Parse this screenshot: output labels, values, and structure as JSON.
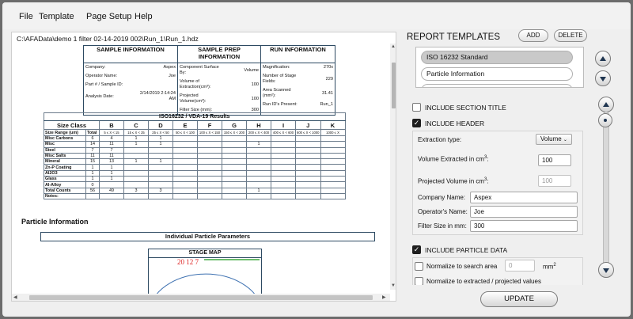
{
  "menu": [
    "File",
    "Template",
    "Page Setup",
    "Help"
  ],
  "document": {
    "path": "C:\\AFAData\\demo 1 filter 02-14-2019 002\\Run_1\\Run_1.hdz",
    "sample_info": {
      "title": "SAMPLE INFORMATION",
      "rows": [
        [
          "Company:",
          "Aspex"
        ],
        [
          "Operator Name:",
          "Joe"
        ],
        [
          "Part # / Sample ID:",
          ""
        ],
        [
          "Analysis Date:",
          "2/14/2019 2:14:24 AM"
        ]
      ]
    },
    "sample_prep": {
      "title": "SAMPLE PREP INFORMATION",
      "rows": [
        [
          "Component Surface By:",
          "Volume"
        ],
        [
          "Volume of Extraction(cm³):",
          "100"
        ],
        [
          "Projected Volume(cm³):",
          "100"
        ],
        [
          "Filter Size (mm):",
          "300"
        ]
      ]
    },
    "run_info": {
      "title": "RUN INFORMATION",
      "rows": [
        [
          "Magnification:",
          "270x"
        ],
        [
          "Number of Stage Fields:",
          "229"
        ],
        [
          "Area Scanned (mm²):",
          "31.41"
        ],
        [
          "Run ID's Present:",
          "Run_1"
        ]
      ]
    },
    "iso": {
      "title": "ISO16232 / VDA-19 Results",
      "size_class_label": "Size Class",
      "classes": [
        "B",
        "C",
        "D",
        "E",
        "F",
        "G",
        "H",
        "I",
        "J",
        "K"
      ],
      "range_label": "Size Range (um)",
      "total_label": "Total",
      "ranges": [
        "5 ≤ X < 15",
        "15 ≤ X < 25",
        "25 ≤ X < 50",
        "50 ≤ X < 100",
        "100 ≤ X < 150",
        "150 ≤ X < 200",
        "200 ≤ X < 400",
        "400 ≤ X < 600",
        "600 ≤ X < 1000",
        "1000 ≤ X"
      ],
      "rows": [
        {
          "label": "Misc Carbons",
          "total": "6",
          "cells": [
            "4",
            "1",
            "1",
            "",
            "",
            "",
            "",
            "",
            "",
            ""
          ]
        },
        {
          "label": "Misc",
          "total": "14",
          "cells": [
            "11",
            "1",
            "1",
            "",
            "",
            "",
            "1",
            "",
            "",
            ""
          ]
        },
        {
          "label": "Steel",
          "total": "7",
          "cells": [
            "7",
            "",
            "",
            "",
            "",
            "",
            "",
            "",
            "",
            ""
          ]
        },
        {
          "label": "Misc Salts",
          "total": "11",
          "cells": [
            "11",
            "",
            "",
            "",
            "",
            "",
            "",
            "",
            "",
            ""
          ]
        },
        {
          "label": "Mineral",
          "total": "15",
          "cells": [
            "13",
            "1",
            "1",
            "",
            "",
            "",
            "",
            "",
            "",
            ""
          ]
        },
        {
          "label": "Zn-P Coating",
          "total": "1",
          "cells": [
            "1",
            "",
            "",
            "",
            "",
            "",
            "",
            "",
            "",
            ""
          ]
        },
        {
          "label": "Al2O3",
          "total": "1",
          "cells": [
            "1",
            "",
            "",
            "",
            "",
            "",
            "",
            "",
            "",
            ""
          ]
        },
        {
          "label": "Glass",
          "total": "1",
          "cells": [
            "1",
            "",
            "",
            "",
            "",
            "",
            "",
            "",
            "",
            ""
          ]
        },
        {
          "label": "Al-Alloy",
          "total": "0",
          "cells": [
            "",
            "",
            "",
            "",
            "",
            "",
            "",
            "",
            "",
            ""
          ]
        },
        {
          "label": "Total Counts",
          "total": "56",
          "cells": [
            "49",
            "3",
            "3",
            "",
            "",
            "",
            "1",
            "",
            "",
            ""
          ]
        },
        {
          "label": "Notes:",
          "total": "",
          "cells": [
            "",
            "",
            "",
            "",
            "",
            "",
            "",
            "",
            "",
            ""
          ]
        }
      ]
    },
    "particle_info_title": "Particle Information",
    "individual_params_title": "Individual Particle Parameters",
    "stage_map_title": "STAGE MAP",
    "stage_map_marks": "20 12 7"
  },
  "panel": {
    "title": "REPORT TEMPLATES",
    "add_label": "ADD",
    "delete_label": "DELETE",
    "templates": [
      "ISO 16232 Standard",
      "Particle Information",
      ""
    ],
    "include_section_title": "INCLUDE SECTION TITLE",
    "include_header": "INCLUDE HEADER",
    "extraction_type_label": "Extraction type:",
    "extraction_type_value": "Volume",
    "volume_extracted_label": "Volume Extracted in cm",
    "volume_extracted_value": "100",
    "projected_volume_label": "Projected Volume in cm",
    "projected_volume_value": "100",
    "company_label": "Company Name:",
    "company_value": "Aspex",
    "operator_label": "Operator's Name:",
    "operator_value": "Joe",
    "filter_label": "Filter Size in mm:",
    "filter_value": "300",
    "include_particle_data": "INCLUDE PARTICLE DATA",
    "normalize_search_label": "Normalize to search area",
    "normalize_search_value": "0",
    "normalize_search_unit": "mm",
    "normalize_extracted_label": "Normalize to extracted / projected values",
    "cube": "3",
    "square": "2",
    "update_label": "UPDATE"
  }
}
